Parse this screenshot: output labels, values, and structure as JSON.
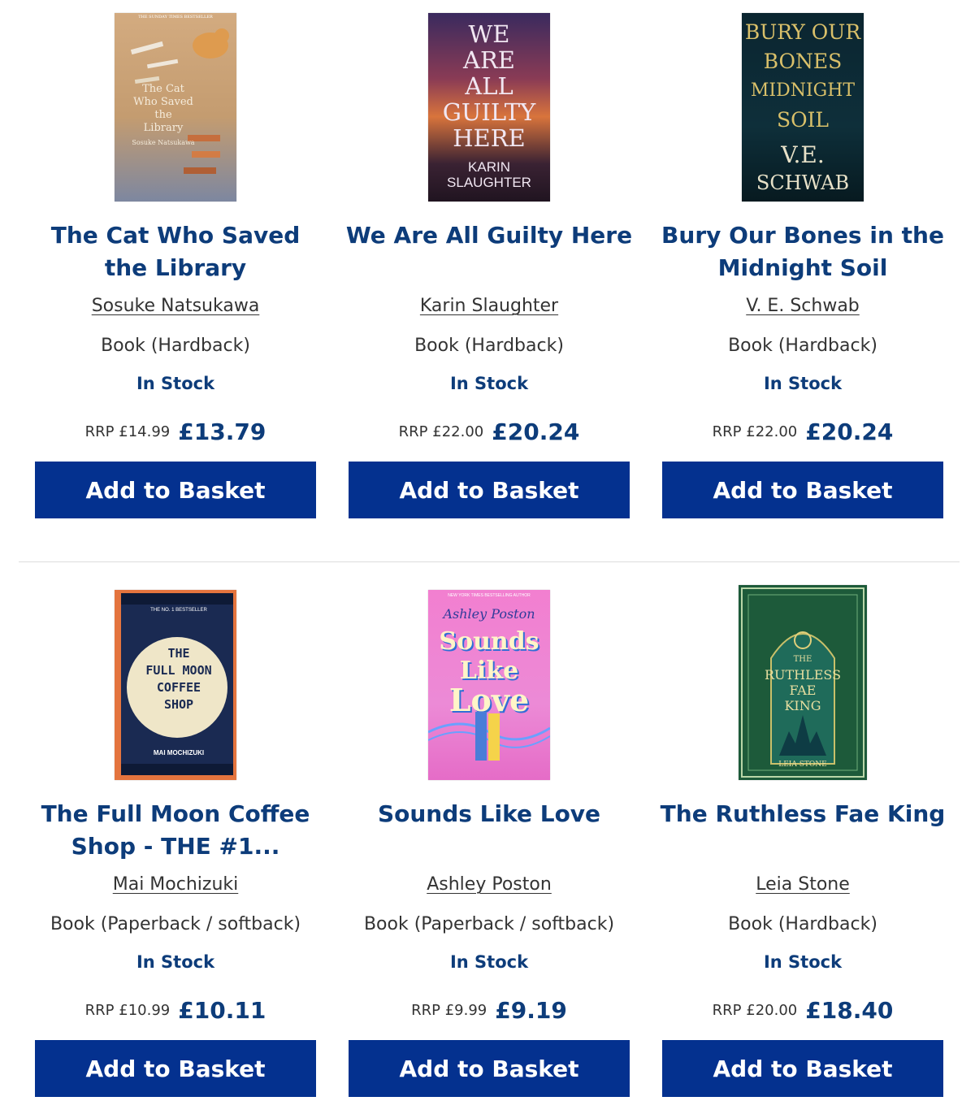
{
  "products": [
    {
      "title": "The Cat Who Saved the Library",
      "author": "Sosuke Natsukawa",
      "format": "Book (Hardback)",
      "stock": "In Stock",
      "rrp": "RRP £14.99",
      "price": "£13.79",
      "button": "Add to Basket",
      "cover": {
        "top_line": "THE SUNDAY TIMES BESTSELLER",
        "title_lines": [
          "The Cat",
          "Who Saved",
          "the",
          "Library"
        ],
        "author": "Sosuke Natsukawa",
        "bg": "#c9a57b"
      }
    },
    {
      "title": "We Are All Guilty Here",
      "author": "Karin Slaughter",
      "format": "Book (Hardback)",
      "stock": "In Stock",
      "rrp": "RRP £22.00",
      "price": "£20.24",
      "button": "Add to Basket",
      "cover": {
        "title_lines": [
          "WE",
          "ARE",
          "ALL",
          "GUILTY",
          "HERE"
        ],
        "author_lines": [
          "KARIN",
          "SLAUGHTER"
        ],
        "bg": "#6a2e44"
      }
    },
    {
      "title": "Bury Our Bones in the Midnight Soil",
      "author": "V. E. Schwab",
      "format": "Book (Hardback)",
      "stock": "In Stock",
      "rrp": "RRP £22.00",
      "price": "£20.24",
      "button": "Add to Basket",
      "cover": {
        "title_lines": [
          "BURY OUR",
          "BONES",
          "MIDNIGHT",
          "SOIL"
        ],
        "author_lines": [
          "V.E.",
          "SCHWAB"
        ],
        "bg": "#0c2730"
      }
    },
    {
      "title": "The Full Moon Coffee Shop - THE #1...",
      "author": "Mai Mochizuki",
      "format": "Book (Paperback / softback)",
      "stock": "In Stock",
      "rrp": "RRP £10.99",
      "price": "£10.11",
      "button": "Add to Basket",
      "cover": {
        "top_line": "THE NO. 1 BESTSELLER",
        "title_lines": [
          "THE",
          "FULL MOON",
          "COFFEE",
          "SHOP"
        ],
        "author": "MAI MOCHIZUKI",
        "bg": "#1a2a52"
      }
    },
    {
      "title": "Sounds Like Love",
      "author": "Ashley Poston",
      "format": "Book (Paperback / softback)",
      "stock": "In Stock",
      "rrp": "RRP £9.99",
      "price": "£9.19",
      "button": "Add to Basket",
      "cover": {
        "top_line": "NEW YORK TIMES BESTSELLING AUTHOR",
        "author": "Ashley Poston",
        "title_lines": [
          "Sounds",
          "Like",
          "Love"
        ],
        "bg": "#f27fd0"
      }
    },
    {
      "title": "The Ruthless Fae King",
      "author": "Leia Stone",
      "format": "Book (Hardback)",
      "stock": "In Stock",
      "rrp": "RRP £20.00",
      "price": "£18.40",
      "button": "Add to Basket",
      "cover": {
        "title_lines": [
          "THE",
          "RUTHLESS",
          "FAE",
          "KING"
        ],
        "author": "LEIA STONE",
        "bg": "#1f5a3a"
      }
    }
  ],
  "colors": {
    "brand": "#0d3c7a",
    "button": "#04318f",
    "divider": "#dcdcdc"
  }
}
